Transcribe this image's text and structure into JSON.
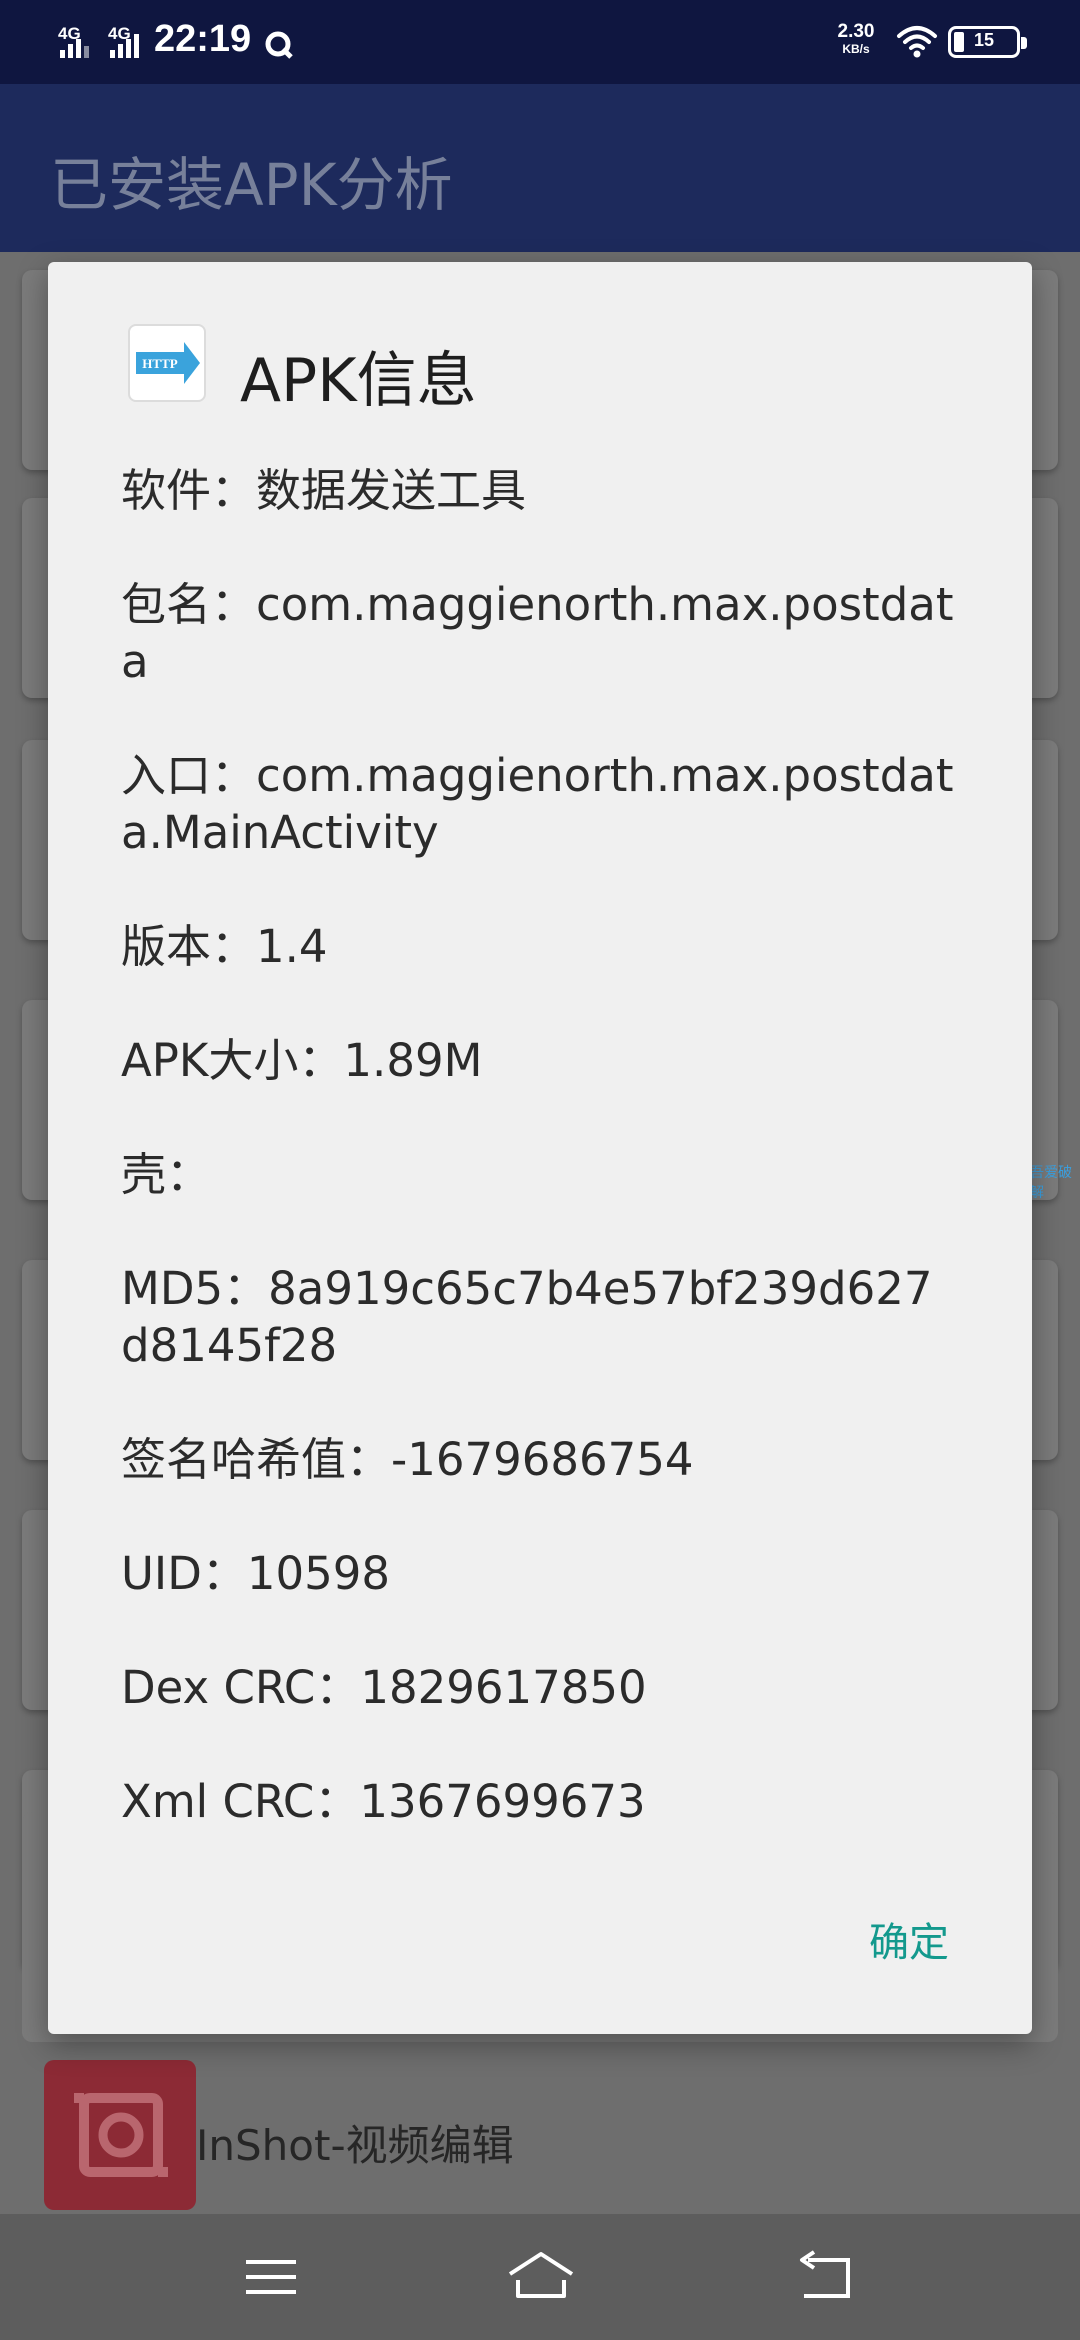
{
  "status_bar": {
    "signal_1": "4G",
    "signal_2": "4G",
    "time": "22:19",
    "net_speed_value": "2.30",
    "net_speed_unit": "KB/s",
    "battery": "15"
  },
  "app_bar": {
    "title": "已安装APK分析"
  },
  "background": {
    "inshot_label": "InShot-视频编辑",
    "side_text": "吾爱破解"
  },
  "dialog": {
    "title": "APK信息",
    "icon_text": "HTTP",
    "items": [
      "软件：数据发送工具",
      "包名：com.maggienorth.max.postdata",
      "入口：com.maggienorth.max.postdata.MainActivity",
      "版本：1.4",
      "APK大小：1.89M",
      "壳：",
      "MD5：8a919c65c7b4e57bf239d627d8145f28",
      "签名哈希值：-1679686754",
      "UID：10598",
      "Dex CRC：1829617850",
      "Xml CRC：1367699673"
    ],
    "ok_label": "确定"
  },
  "icons": {
    "q_status": "q-notification-icon",
    "wifi": "wifi-icon",
    "menu": "menu-icon",
    "home": "home-icon",
    "back": "back-icon"
  }
}
